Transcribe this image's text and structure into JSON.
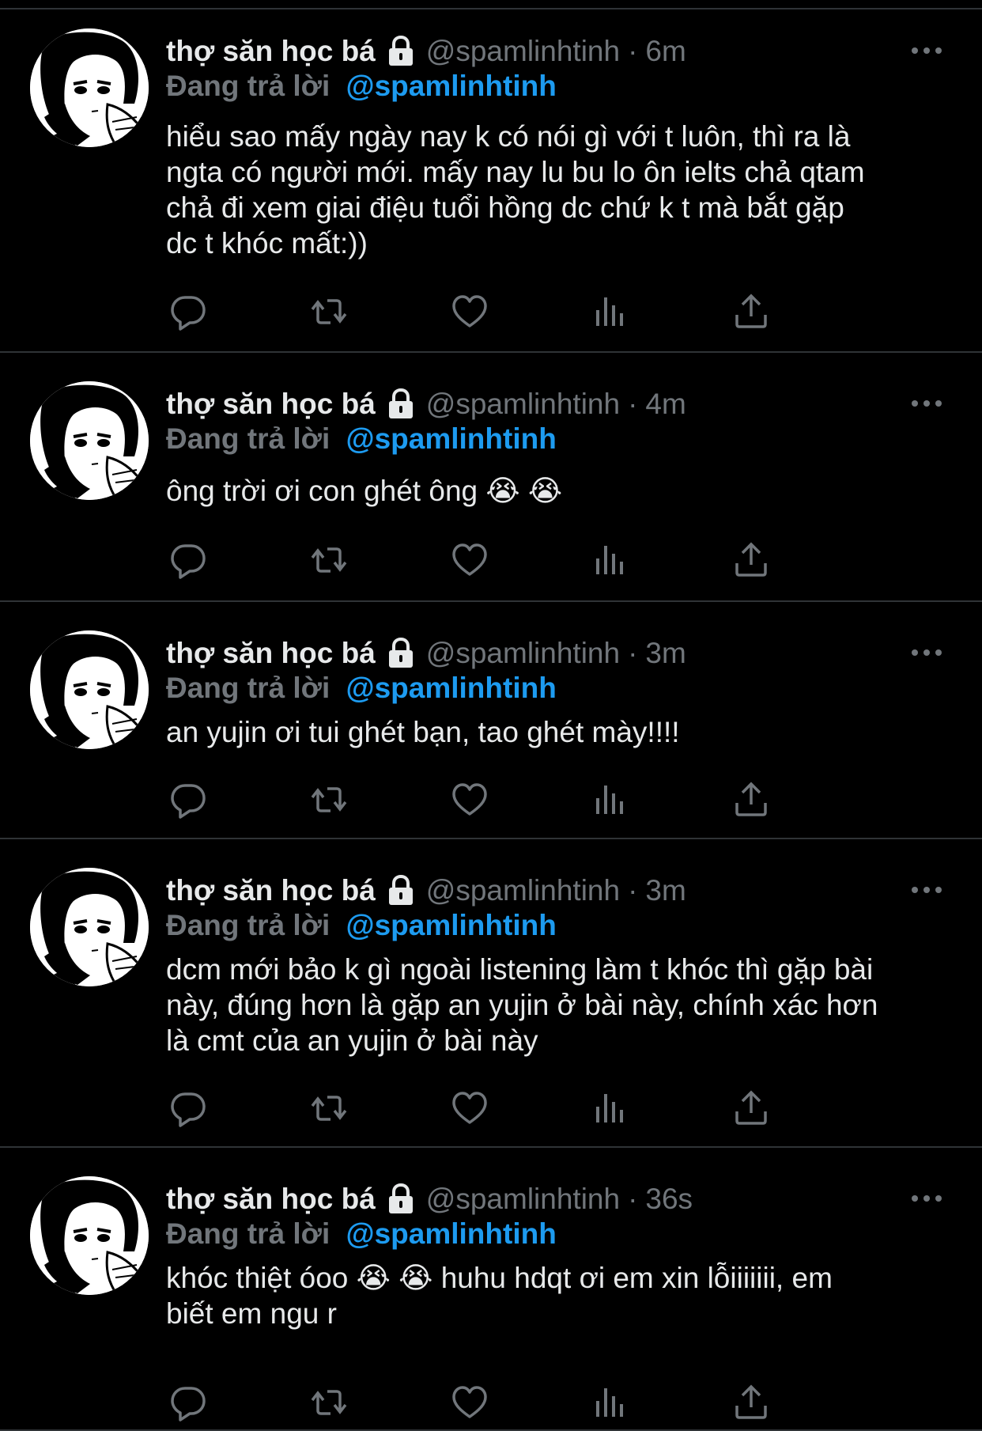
{
  "colors": {
    "background": "#000000",
    "text": "#e7e9ea",
    "secondary": "#71767b",
    "mention": "#1d9bf0",
    "divider": "#2f3336"
  },
  "icons": {
    "lock": "lock-icon",
    "more": "more-icon",
    "reply": "reply-icon",
    "retweet": "retweet-icon",
    "like": "like-icon",
    "views": "views-icon",
    "share": "share-icon"
  },
  "tweets": [
    {
      "name": "thợ săn học bá",
      "handle": "@spamlinhtinh",
      "dot": "·",
      "time": "6m",
      "replying_prefix": "Đang trả lời",
      "replying_to": "@spamlinhtinh",
      "lines": [
        "hiểu sao mấy ngày nay k có nói gì với t luôn, thì ra là",
        "ngta có người mới. mấy nay lu bu lo ôn ielts chả qtam",
        "chả đi xem giai điệu tuổi hồng dc chứ k t mà bắt gặp",
        "dc t khóc mất:))"
      ]
    },
    {
      "name": "thợ săn học bá",
      "handle": "@spamlinhtinh",
      "dot": "·",
      "time": "4m",
      "replying_prefix": "Đang trả lời",
      "replying_to": "@spamlinhtinh",
      "lines": [
        "ông trời ơi con ghét ông 😭 😭"
      ]
    },
    {
      "name": "thợ săn học bá",
      "handle": "@spamlinhtinh",
      "dot": "·",
      "time": "3m",
      "replying_prefix": "Đang trả lời",
      "replying_to": "@spamlinhtinh",
      "lines": [
        "an yujin ơi tui ghét bạn, tao ghét mày!!!!"
      ]
    },
    {
      "name": "thợ săn học bá",
      "handle": "@spamlinhtinh",
      "dot": "·",
      "time": "3m",
      "replying_prefix": "Đang trả lời",
      "replying_to": "@spamlinhtinh",
      "lines": [
        "dcm mới bảo k gì ngoài listening làm t khóc thì gặp bài",
        "này, đúng hơn là gặp an yujin ở bài này, chính xác hơn",
        "là cmt của an yujin ở bài này"
      ]
    },
    {
      "name": "thợ săn học bá",
      "handle": "@spamlinhtinh",
      "dot": "·",
      "time": "36s",
      "replying_prefix": "Đang trả lời",
      "replying_to": "@spamlinhtinh",
      "lines": [
        "khóc thiệt óoo 😭 😭  huhu hdqt ơi em xin lỗiiiiiii, em",
        "biết em ngu r"
      ]
    }
  ]
}
